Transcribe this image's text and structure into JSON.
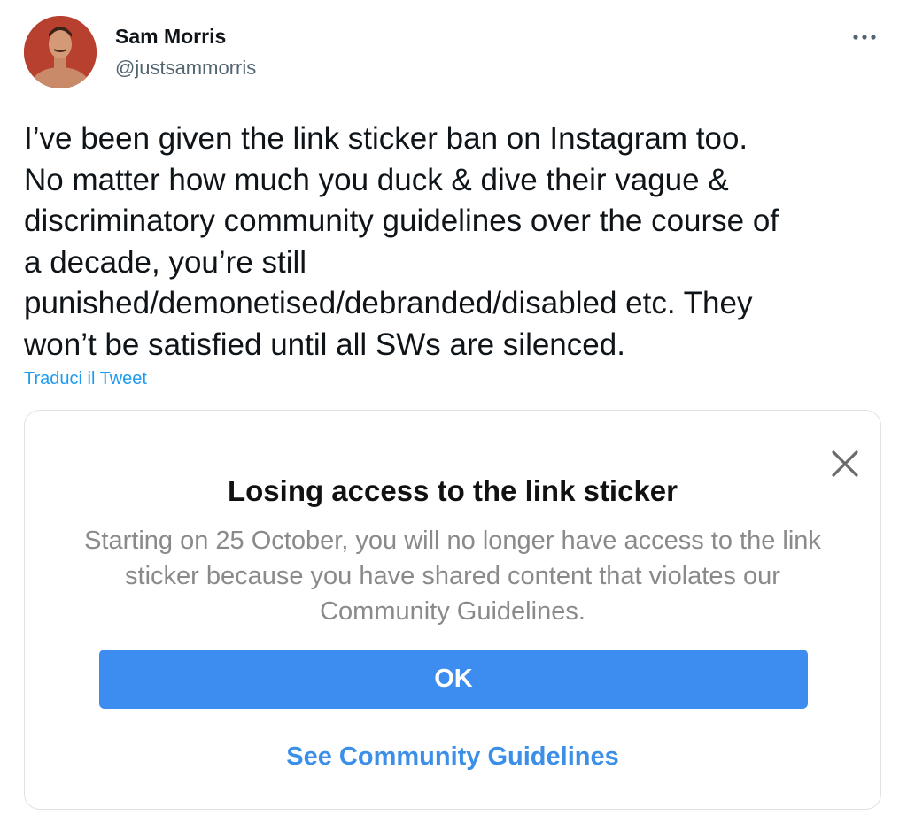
{
  "tweet": {
    "author": {
      "name": "Sam Morris",
      "handle": "@justsammorris",
      "avatar_icon": "profile-photo"
    },
    "more_icon": "more-horizontal-icon",
    "text": "I’ve been given the link sticker ban on Instagram too.\nNo matter how much you duck & dive their vague &\ndiscriminatory community guidelines over the course of\na decade, you’re still\npunished/demonetised/debranded/disabled etc. They\nwon’t be satisfied until all SWs are silenced.",
    "translate_label": "Traduci il Tweet"
  },
  "embedded_dialog": {
    "close_icon": "close-icon",
    "title": "Losing access to the link sticker",
    "message": "Starting on 25 October, you will no longer have access to the link sticker because you have shared content that violates our Community Guidelines.",
    "ok_label": "OK",
    "guidelines_label": "See Community Guidelines"
  },
  "colors": {
    "twitter_blue": "#1d9bf0",
    "instagram_button_blue": "#3d8cef",
    "instagram_link_blue": "#3b8fe8",
    "muted_gray": "#536471"
  }
}
